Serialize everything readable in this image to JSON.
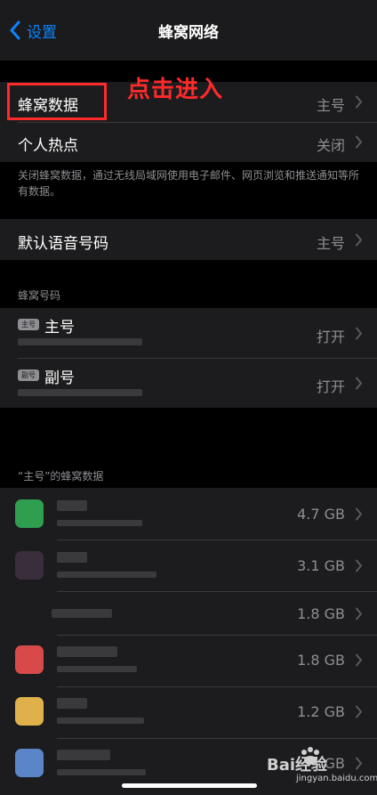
{
  "nav": {
    "back_label": "设置",
    "title": "蜂窝网络"
  },
  "annotation": "点击进入",
  "rows_top": {
    "cellular_data": {
      "label": "蜂窝数据",
      "value": "主号"
    },
    "hotspot": {
      "label": "个人热点",
      "value": "关闭"
    }
  },
  "note": "关闭蜂窝数据，通过无线局域网使用电子邮件、网页浏览和推送通知等所有数据。",
  "default_voice": {
    "label": "默认语音号码",
    "value": "主号"
  },
  "sim_section": {
    "title": "蜂窝号码",
    "items": [
      {
        "badge": "主号",
        "name": "主号",
        "status": "打开"
      },
      {
        "badge": "副号",
        "name": "副号",
        "status": "打开"
      }
    ]
  },
  "usage_section": {
    "title": "“主号”的蜂窝数据",
    "items": [
      {
        "size": "4.7 GB",
        "icon_color": "#2f9e4f"
      },
      {
        "size": "3.1 GB",
        "icon_color": "#3a2d3c"
      },
      {
        "size": "1.8 GB",
        "icon_color": ""
      },
      {
        "size": "1.8 GB",
        "icon_color": "#d84a4a"
      },
      {
        "size": "1.2 GB",
        "icon_color": "#e0b04a"
      },
      {
        "size": "GB",
        "icon_color": "#5a86c8"
      }
    ]
  },
  "watermark": {
    "brand": "Bai经验",
    "domain": "jingyan.baidu.com"
  },
  "colors": {
    "accent": "#0a84ff",
    "annotation": "#ff2a2a",
    "secondary": "#8e8e93"
  }
}
